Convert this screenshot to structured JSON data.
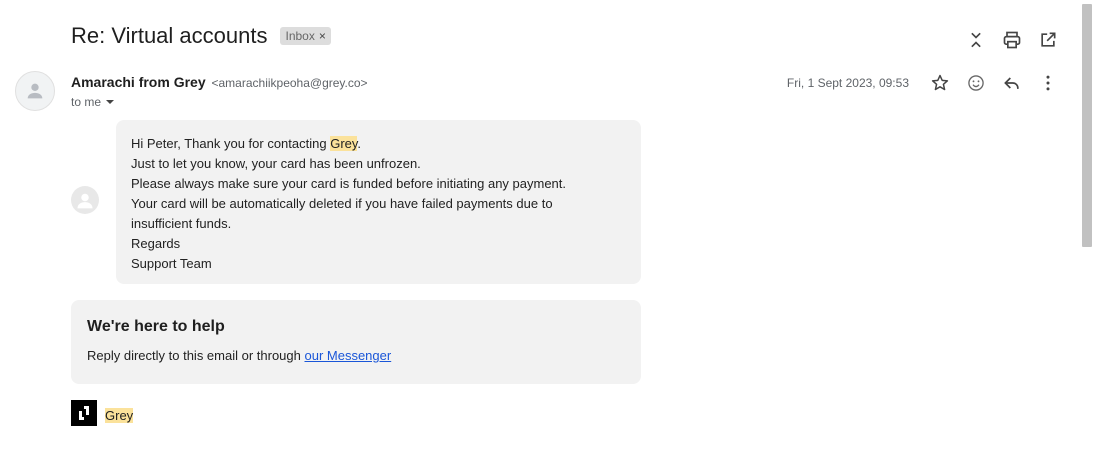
{
  "email": {
    "subject": "Re: Virtual accounts",
    "label": "Inbox",
    "label_remove": "×",
    "sender_name": "Amarachi from Grey",
    "sender_email": "<amarachiikpeoha@grey.co>",
    "recipient": "to me",
    "date": "Fri, 1 Sept 2023, 09:53",
    "body": {
      "line1_prefix": "Hi Peter, Thank you for contacting ",
      "line1_highlight": "Grey",
      "line1_suffix": ".",
      "line2": "Just to let you know, your card has been unfrozen.",
      "line3": "Please always make sure your card is funded before initiating any payment.",
      "line4": "Your card will be automatically deleted if you have failed payments due to",
      "line5": "insufficient funds.",
      "line6": "Regards",
      "line7": "Support Team"
    }
  },
  "help": {
    "title": "We're here to help",
    "text": "Reply directly to this email or through ",
    "link": "our Messenger"
  },
  "signature": {
    "brand": "Grey"
  },
  "icons": {
    "collapse": "collapse-icon",
    "print": "print-icon",
    "open_new": "open-new-window-icon",
    "star": "star-icon",
    "emoji": "emoji-icon",
    "reply": "reply-icon",
    "more": "more-vert-icon"
  },
  "colors": {
    "highlight": "#fbe29b",
    "link": "#1a56d8",
    "card_bg": "#f2f2f2"
  }
}
